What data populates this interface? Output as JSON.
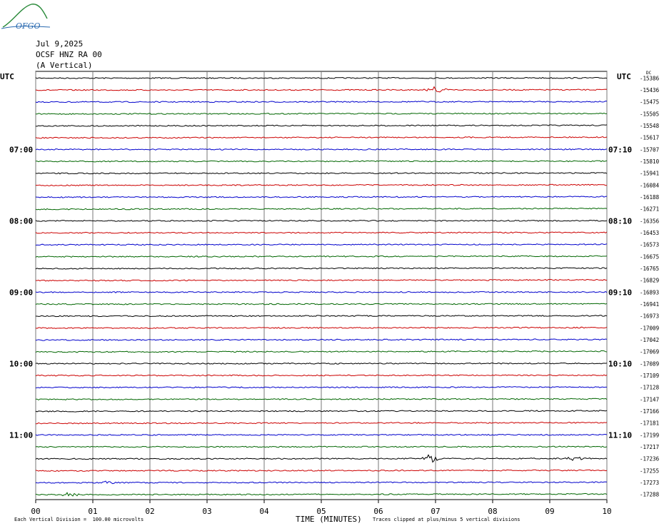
{
  "header": {
    "date": "Jul 9,2025",
    "station": "OCSF HNZ RA 00",
    "component": "(A Vertical)",
    "utc_left": "UTC",
    "utc_right": "UTC",
    "dc_label": "DC"
  },
  "logo": {
    "text": "OFGO"
  },
  "footer": {
    "scale": "Each Vertical Division =  100.00 microvolts",
    "xlabel": "TIME (MINUTES)",
    "clip_note": "Traces clipped at plus/minus 5 vertical divisions"
  },
  "chart_data": {
    "type": "line",
    "title": "",
    "xlabel": "TIME (MINUTES)",
    "x_ticks": [
      "00",
      "01",
      "02",
      "03",
      "04",
      "05",
      "06",
      "07",
      "08",
      "09",
      "10"
    ],
    "xlim": [
      0,
      10
    ],
    "grid": true,
    "trace_colors": [
      "#000000",
      "#cc0000",
      "#0000cc",
      "#006600"
    ],
    "left_hour_labels": [
      {
        "trace": 6,
        "label": "07:00"
      },
      {
        "trace": 12,
        "label": "08:00"
      },
      {
        "trace": 18,
        "label": "09:00"
      },
      {
        "trace": 24,
        "label": "10:00"
      },
      {
        "trace": 30,
        "label": "11:00"
      }
    ],
    "right_hour_labels": [
      {
        "trace": 6,
        "label": "07:10"
      },
      {
        "trace": 12,
        "label": "08:10"
      },
      {
        "trace": 18,
        "label": "09:10"
      },
      {
        "trace": 24,
        "label": "10:10"
      },
      {
        "trace": 30,
        "label": "11:10"
      }
    ],
    "dc_offsets": [
      "-15386",
      "-15436",
      "-15475",
      "-15505",
      "-15548",
      "-15617",
      "-15707",
      "-15810",
      "-15941",
      "-16084",
      "-16188",
      "-16271",
      "-16356",
      "-16453",
      "-16573",
      "-16675",
      "-16765",
      "-16829",
      "-16893",
      "-16941",
      "-16973",
      "-17009",
      "-17042",
      "-17069",
      "-17089",
      "-17109",
      "-17128",
      "-17147",
      "-17166",
      "-17181",
      "-17199",
      "-17217",
      "-17236",
      "-17255",
      "-17273",
      "-17288"
    ],
    "events": [
      {
        "trace": 1,
        "minute": 7.0,
        "amp": 5
      },
      {
        "trace": 32,
        "minute": 6.9,
        "amp": 7
      },
      {
        "trace": 32,
        "minute": 9.45,
        "amp": 3
      },
      {
        "trace": 34,
        "minute": 1.25,
        "amp": 2
      },
      {
        "trace": 35,
        "minute": 0.62,
        "amp": 3
      }
    ]
  }
}
